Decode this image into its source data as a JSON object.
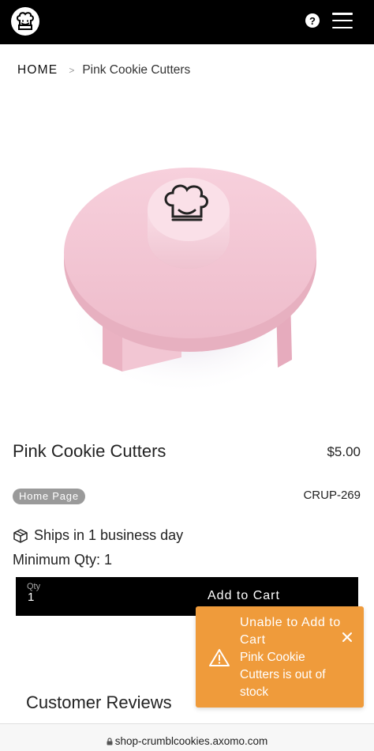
{
  "header": {
    "logo_icon": "chef-logo-icon",
    "help_icon": "help-icon",
    "help_glyph": "?",
    "menu_icon": "hamburger-menu-icon"
  },
  "breadcrumb": {
    "home": "HOME",
    "separator": ">",
    "current": "Pink Cookie Cutters"
  },
  "product": {
    "image_description_icon": "pink-cookie-cutter-image",
    "title": "Pink Cookie Cutters",
    "price": "$5.00",
    "badge": "Home Page",
    "sku": "CRUP-269",
    "shipping": "Ships in 1 business day",
    "shipping_icon": "box-icon",
    "min_qty": "Minimum Qty: 1"
  },
  "cart": {
    "qty_label": "Qty",
    "qty_value": "1",
    "add_label": "Add to Cart"
  },
  "reviews": {
    "heading": "Customer Reviews"
  },
  "toast": {
    "title": "Unable to Add to Cart",
    "message": "Pink Cookie Cutters is out of stock",
    "icon": "warning-icon",
    "close_icon": "close-icon",
    "color": "#ef9b3b"
  },
  "browser": {
    "url": "shop-crumblcookies.axomo.com",
    "lock_icon": "lock-icon"
  },
  "colors": {
    "topbar": "#000000",
    "product_pink": "#f0bccb",
    "badge": "#9a9a9a"
  }
}
